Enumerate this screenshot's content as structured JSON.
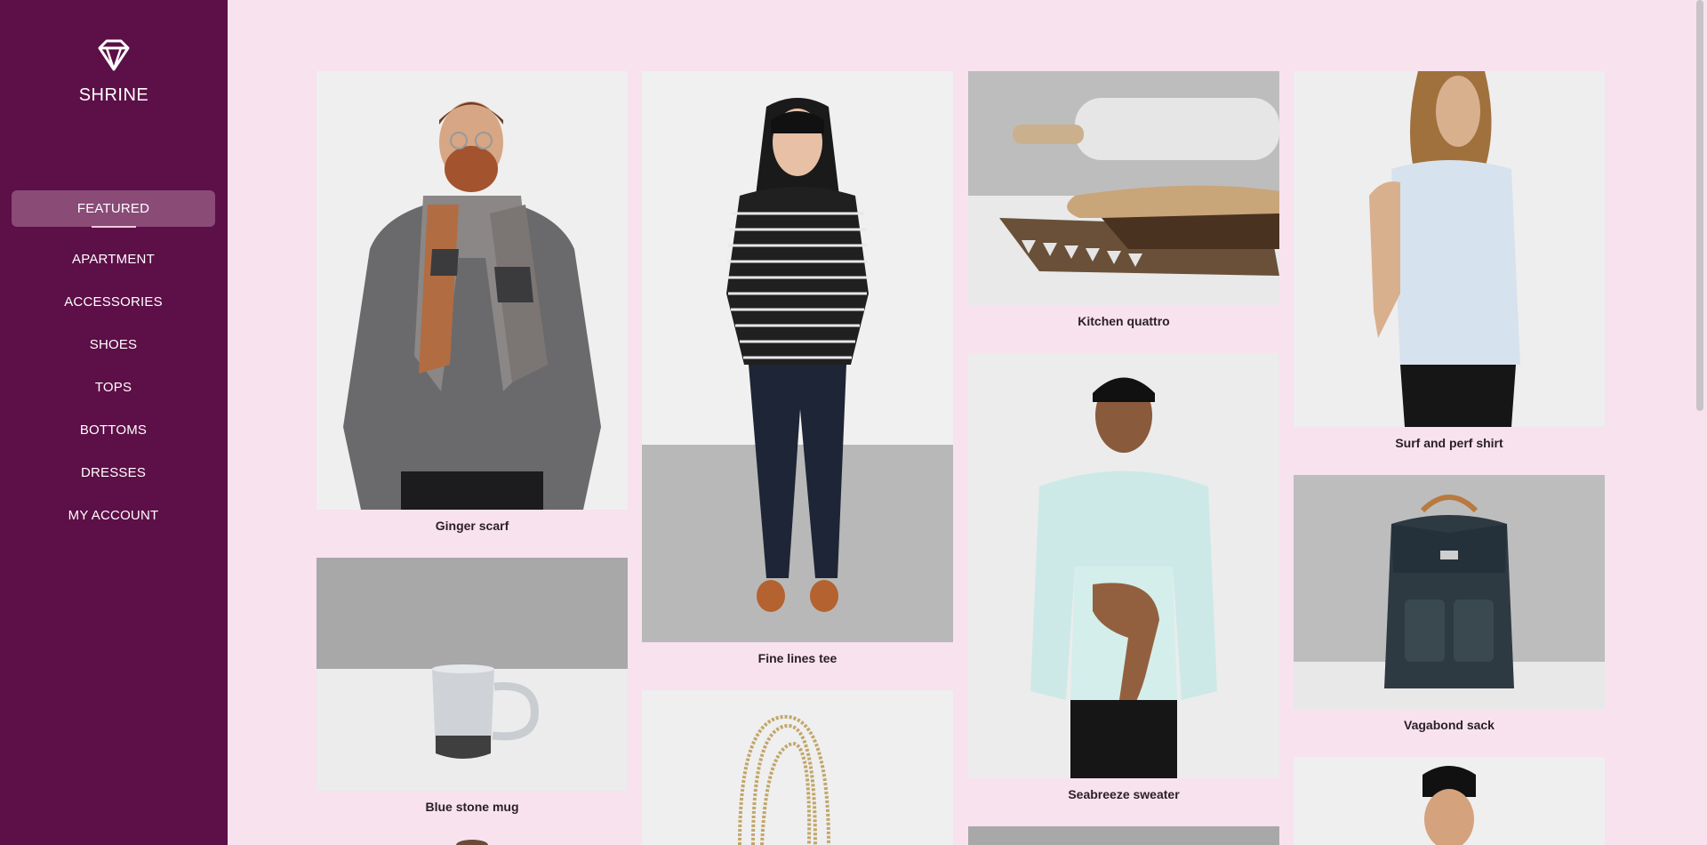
{
  "app": {
    "brand": "SHRINE"
  },
  "nav": {
    "items": [
      {
        "label": "FEATURED",
        "active": true
      },
      {
        "label": "APARTMENT",
        "active": false
      },
      {
        "label": "ACCESSORIES",
        "active": false
      },
      {
        "label": "SHOES",
        "active": false
      },
      {
        "label": "TOPS",
        "active": false
      },
      {
        "label": "BOTTOMS",
        "active": false
      },
      {
        "label": "DRESSES",
        "active": false
      },
      {
        "label": "MY ACCOUNT",
        "active": false
      }
    ]
  },
  "colors": {
    "sidebar_bg": "#5d0f47",
    "page_bg": "#f7e2ee",
    "active_item_bg": "#8a4b77"
  },
  "products": [
    {
      "name": "Ginger scarf"
    },
    {
      "name": "Blue stone mug"
    },
    {
      "name": "Fine lines tee"
    },
    {
      "name": "Kitchen quattro"
    },
    {
      "name": "Seabreeze sweater"
    },
    {
      "name": "Surf and perf shirt"
    },
    {
      "name": "Vagabond sack"
    }
  ]
}
